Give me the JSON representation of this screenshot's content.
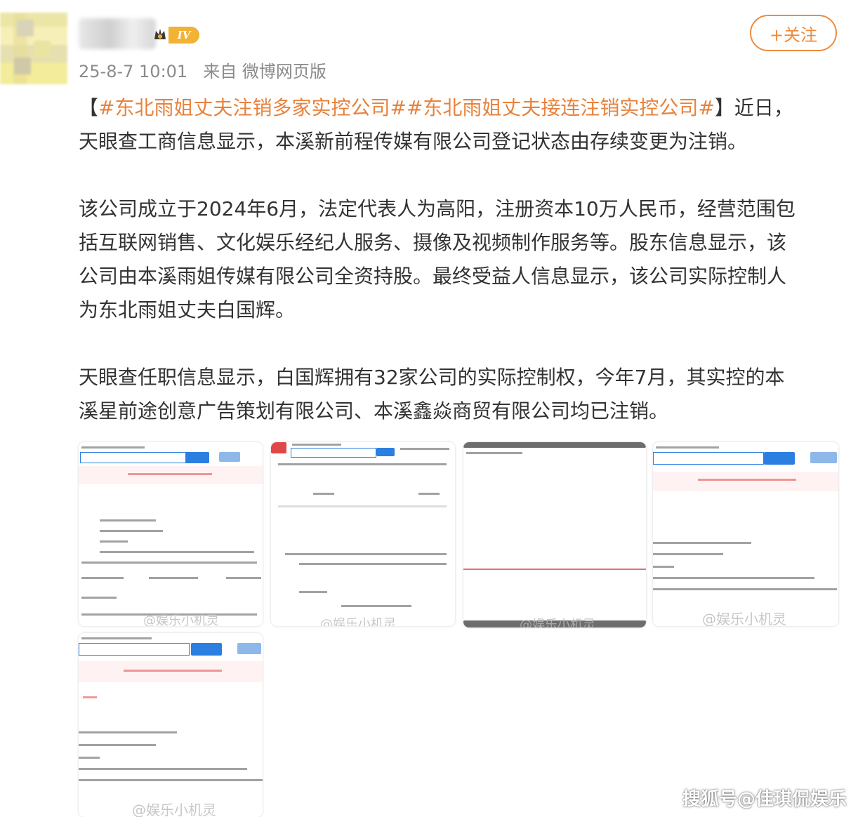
{
  "post": {
    "level": "IV",
    "time": "25-8-7 10:01",
    "source": "来自 微博网页版",
    "follow_label": "+关注",
    "p1_bracket_open": "【",
    "p1_tags": "#东北雨姐丈夫注销多家实控公司##东北雨姐丈夫接连注销实控公司#",
    "p1_bracket_close": "】近日，",
    "p1_line2": "天眼查工商信息显示，本溪新前程传媒有限公司登记状态由存续变更为注销。",
    "p2_lines": [
      "该公司成立于2024年6月，法定代表人为高阳，注册资本10万人民币，经营范围包",
      "括互联网销售、文化娱乐经纪人服务、摄像及视频制作服务等。股东信息显示，该",
      "公司由本溪雨姐传媒有限公司全资持股。最终受益人信息显示，该公司实际控制人",
      "为东北雨姐丈夫白国辉。"
    ],
    "p3_lines": [
      "天眼查任职信息显示，白国辉拥有32家公司的实际控制权，今年7月，其实控的本",
      "溪星前途创意广告策划有限公司、本溪鑫焱商贸有限公司均已注销。"
    ]
  },
  "thumb_watermark": "@娱乐小机灵",
  "site_watermark": "搜狐号@佳琪侃娱乐",
  "colors": {
    "accent": "#f08a3a",
    "tag": "#e8823c",
    "text": "#333333",
    "meta": "#8b8b8b"
  }
}
